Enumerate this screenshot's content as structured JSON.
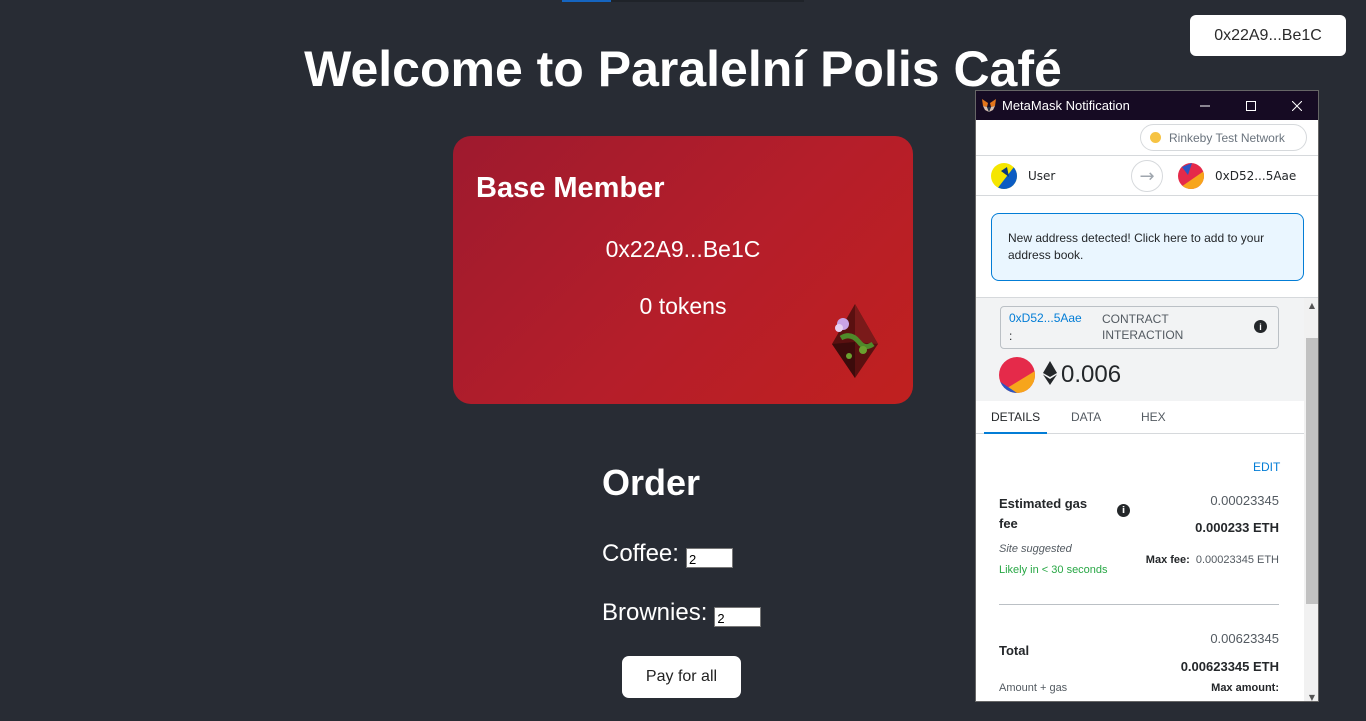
{
  "header": {
    "account_button": "0x22A9...Be1C"
  },
  "page": {
    "title": "Welcome to Paralelní Polis Café"
  },
  "member_card": {
    "tier": "Base Member",
    "address": "0x22A9...Be1C",
    "tokens": "0 tokens"
  },
  "order": {
    "title": "Order",
    "items": [
      {
        "label": "Coffee:",
        "value": "2"
      },
      {
        "label": "Brownies:",
        "value": "2"
      }
    ],
    "pay_button": "Pay for all"
  },
  "metamask": {
    "window_title": "MetaMask Notification",
    "network": "Rinkeby Test Network",
    "from_label": "User",
    "to_label": "0xD52...5Aae",
    "notice": "New address detected! Click here to add to your address book.",
    "origin_address": "0xD52...5Aae",
    "origin_colon": ":",
    "interaction_type": "CONTRACT INTERACTION",
    "amount": "0.006",
    "tabs": [
      "DETAILS",
      "DATA",
      "HEX"
    ],
    "edit": "EDIT",
    "gas_label": "Estimated gas fee",
    "gas_approx": "0.00023345",
    "gas_eth": "0.000233 ETH",
    "site_suggested": "Site suggested",
    "likely": "Likely in < 30 seconds",
    "max_fee_label": "Max fee:",
    "max_fee_value": "0.00023345 ETH",
    "total_label": "Total",
    "total_approx": "0.00623345",
    "total_eth": "0.00623345 ETH",
    "amount_gas": "Amount + gas",
    "max_amount": "Max amount:"
  },
  "colors": {
    "background": "#282c34",
    "card_red": "#b51e2a",
    "metamask_blue": "#037dd6",
    "success_green": "#28a745"
  },
  "icons": [
    "metamask-fox-icon",
    "minimize-icon",
    "maximize-icon",
    "close-icon",
    "arrow-right-icon",
    "info-icon",
    "ethereum-icon",
    "nft-gem-icon"
  ]
}
